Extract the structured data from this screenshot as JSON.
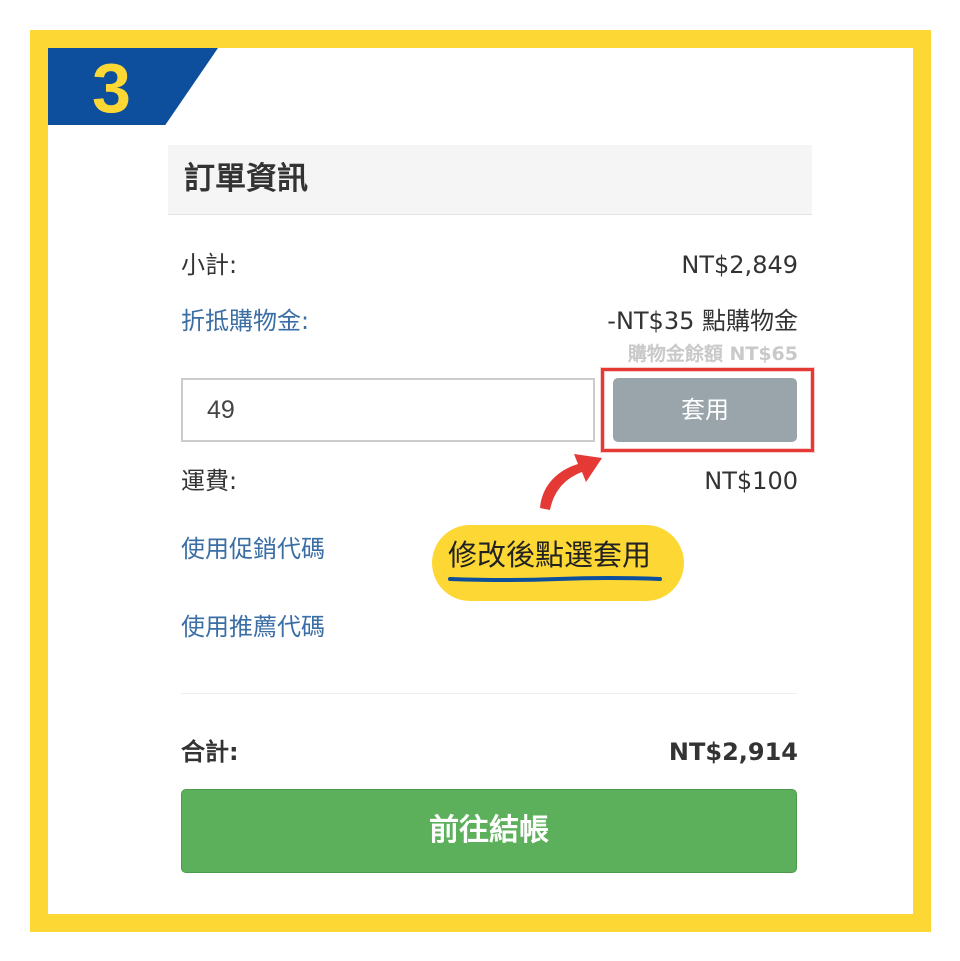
{
  "step_badge": {
    "number": "3"
  },
  "order_info": {
    "title": "訂單資訊",
    "subtotal": {
      "label": "小計:",
      "value": "NT$2,849"
    },
    "credit": {
      "label": "折抵購物金:",
      "value": "-NT$35 點購物金",
      "balance": "購物金餘額 NT$65"
    },
    "credit_input": {
      "value": "49"
    },
    "apply_button": {
      "label": "套用"
    },
    "shipping": {
      "label": "運費:",
      "value": "NT$100"
    },
    "promo_link": "使用促銷代碼",
    "referral_link": "使用推薦代碼",
    "total": {
      "label": "合計:",
      "value": "NT$2,914"
    },
    "checkout_button": {
      "label": "前往結帳"
    }
  },
  "annotation": {
    "callout_text": "修改後點選套用"
  },
  "colors": {
    "frame_yellow": "#FDD835",
    "badge_blue": "#0d4f9c",
    "link_blue": "#3a6ea5",
    "apply_gray": "#9aa5ab",
    "highlight_red": "#e53935",
    "checkout_green": "#5cb05b"
  }
}
